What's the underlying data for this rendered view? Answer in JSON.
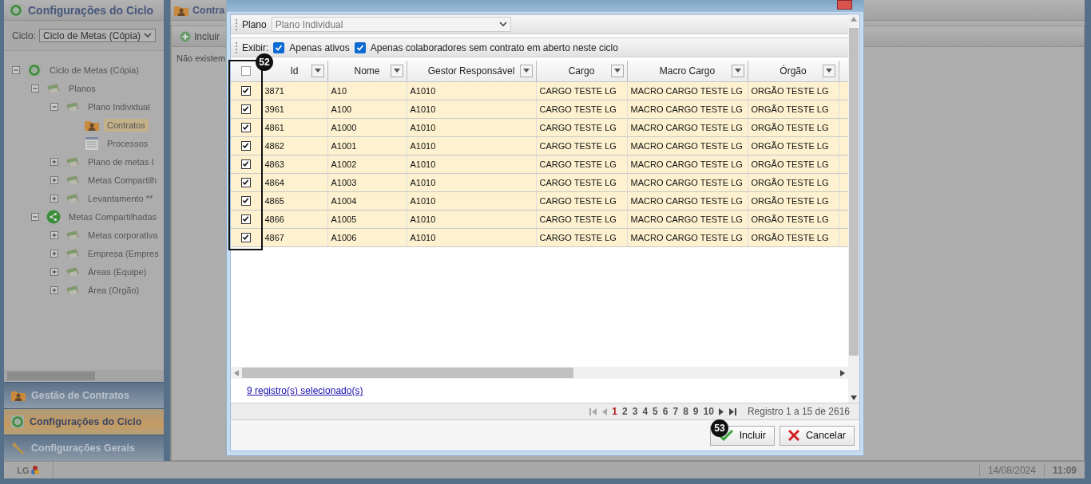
{
  "left_panel": {
    "title": "Configurações do Ciclo",
    "cycle_label": "Ciclo:",
    "cycle_value": "Ciclo de Metas (Cópia)",
    "tree": [
      {
        "label": "Ciclo de Metas (Cópia)",
        "kind": "cycle",
        "expanded": true,
        "selected": false,
        "children": [
          {
            "label": "Planos",
            "kind": "plan",
            "expanded": true,
            "selected": false,
            "children": [
              {
                "label": "Plano Individual",
                "kind": "plan",
                "expanded": true,
                "selected": false,
                "children": [
                  {
                    "label": "Contratos",
                    "kind": "contracts",
                    "selected": true
                  },
                  {
                    "label": "Processos",
                    "kind": "process",
                    "selected": false
                  }
                ]
              },
              {
                "label": "Plano de metas I",
                "kind": "plan",
                "expanded": false,
                "selected": false
              },
              {
                "label": "Metas Compartilh",
                "kind": "plan",
                "expanded": false,
                "selected": false
              },
              {
                "label": "Levantamento **",
                "kind": "plan",
                "expanded": false,
                "selected": false
              }
            ]
          },
          {
            "label": "Metas Compartilhadas",
            "kind": "share",
            "expanded": true,
            "selected": false,
            "children": [
              {
                "label": "Metas corporativa",
                "kind": "plan",
                "expanded": false,
                "selected": false
              },
              {
                "label": "Empresa (Empres",
                "kind": "plan",
                "expanded": false,
                "selected": false
              },
              {
                "label": "Áreas (Equipe)",
                "kind": "plan",
                "expanded": false,
                "selected": false
              },
              {
                "label": "Área (Orgão)",
                "kind": "plan",
                "expanded": false,
                "selected": false
              }
            ]
          }
        ]
      }
    ],
    "nav": [
      {
        "label": "Gestão de Contratos",
        "kind": "contracts",
        "selected": false
      },
      {
        "label": "Configurações do Ciclo",
        "kind": "cycle",
        "selected": true
      },
      {
        "label": "Configurações Gerais",
        "kind": "tools",
        "selected": false
      }
    ]
  },
  "main": {
    "title": "Contra",
    "toolbar_button": "Incluir",
    "message": "Não existem"
  },
  "dialog": {
    "plano_label": "Plano",
    "plano_value": "Plano Individual",
    "filter_label": "Exibir:",
    "filters": [
      {
        "label": "Apenas ativos",
        "checked": true
      },
      {
        "label": "Apenas colaboradores sem contrato em aberto neste ciclo",
        "checked": true
      }
    ],
    "select_all_checked": false,
    "columns": [
      "Id",
      "Nome",
      "Gestor Responsável",
      "Cargo",
      "Macro Cargo",
      "Órgão"
    ],
    "rows": [
      {
        "checked": true,
        "cells": [
          "3871",
          "A10",
          "A1010",
          "CARGO TESTE LG",
          "MACRO CARGO TESTE LG",
          "ORGÃO TESTE LG"
        ]
      },
      {
        "checked": true,
        "cells": [
          "3961",
          "A100",
          "A1010",
          "CARGO TESTE LG",
          "MACRO CARGO TESTE LG",
          "ORGÃO TESTE LG"
        ]
      },
      {
        "checked": true,
        "cells": [
          "4861",
          "A1000",
          "A1010",
          "CARGO TESTE LG",
          "MACRO CARGO TESTE LG",
          "ORGÃO TESTE LG"
        ]
      },
      {
        "checked": true,
        "cells": [
          "4862",
          "A1001",
          "A1010",
          "CARGO TESTE LG",
          "MACRO CARGO TESTE LG",
          "ORGÃO TESTE LG"
        ]
      },
      {
        "checked": true,
        "cells": [
          "4863",
          "A1002",
          "A1010",
          "CARGO TESTE LG",
          "MACRO CARGO TESTE LG",
          "ORGÃO TESTE LG"
        ]
      },
      {
        "checked": true,
        "cells": [
          "4864",
          "A1003",
          "A1010",
          "CARGO TESTE LG",
          "MACRO CARGO TESTE LG",
          "ORGÃO TESTE LG"
        ]
      },
      {
        "checked": true,
        "cells": [
          "4865",
          "A1004",
          "A1010",
          "CARGO TESTE LG",
          "MACRO CARGO TESTE LG",
          "ORGÃO TESTE LG"
        ]
      },
      {
        "checked": true,
        "cells": [
          "4866",
          "A1005",
          "A1010",
          "CARGO TESTE LG",
          "MACRO CARGO TESTE LG",
          "ORGÃO TESTE LG"
        ]
      },
      {
        "checked": true,
        "cells": [
          "4867",
          "A1006",
          "A1010",
          "CARGO TESTE LG",
          "MACRO CARGO TESTE LG",
          "ORGÃO TESTE LG"
        ]
      }
    ],
    "selection_link": "9 registro(s) selecionado(s)",
    "pages": [
      {
        "label": "1",
        "selected": true
      },
      {
        "label": "2",
        "selected": false
      },
      {
        "label": "3",
        "selected": false
      },
      {
        "label": "4",
        "selected": false
      },
      {
        "label": "5",
        "selected": false
      },
      {
        "label": "6",
        "selected": false
      },
      {
        "label": "7",
        "selected": false
      },
      {
        "label": "8",
        "selected": false
      },
      {
        "label": "9",
        "selected": false
      },
      {
        "label": "10",
        "selected": false
      }
    ],
    "pager_summary": "Registro 1 a 15 de 2616",
    "buttons": [
      {
        "label": "Incluir",
        "kind": "confirm"
      },
      {
        "label": "Cancelar",
        "kind": "cancel"
      }
    ],
    "grid_callout": "52",
    "button_callout": "53"
  },
  "status_bar": {
    "logo": "LG",
    "date": "14/08/2024",
    "time": "11:09"
  }
}
